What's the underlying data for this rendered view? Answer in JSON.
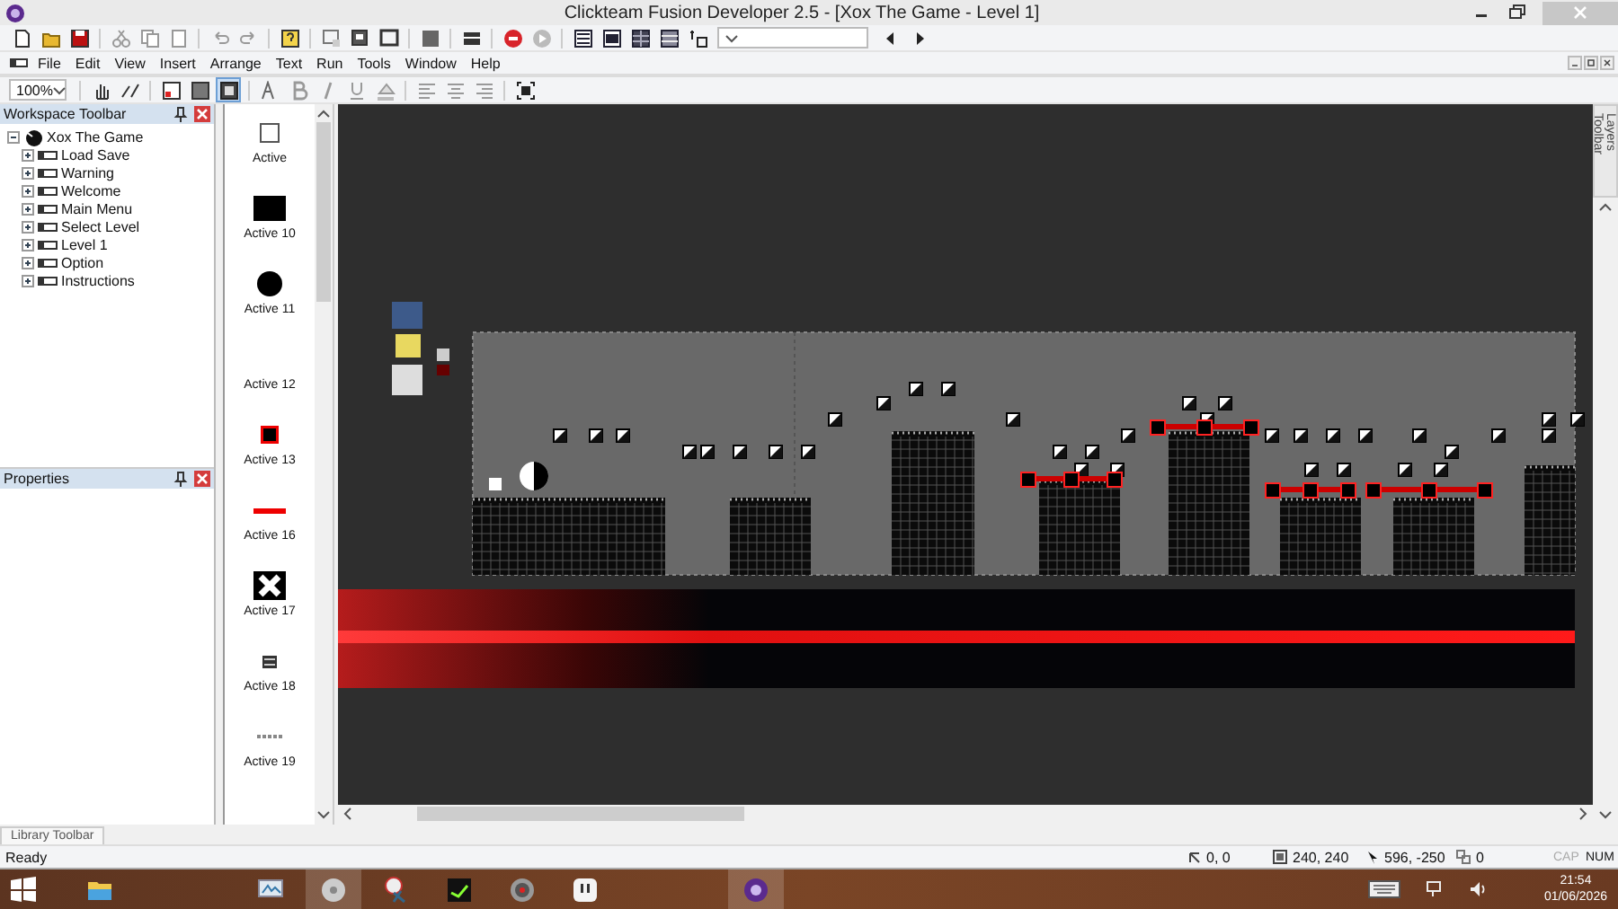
{
  "window": {
    "title": "Clickteam Fusion Developer 2.5 - [Xox The Game - Level 1]"
  },
  "menu": [
    "File",
    "Edit",
    "View",
    "Insert",
    "Arrange",
    "Text",
    "Run",
    "Tools",
    "Window",
    "Help"
  ],
  "format_bar": {
    "zoom": "100%",
    "view_toggles": [
      {
        "selected": false
      },
      {
        "selected": false
      },
      {
        "selected": true
      }
    ]
  },
  "workspace": {
    "title": "Workspace Toolbar",
    "tree": [
      {
        "label": "Xox The Game",
        "expanded": true,
        "children": [
          {
            "label": "Load Save",
            "expanded": false
          },
          {
            "label": "Warning",
            "expanded": false
          },
          {
            "label": "Welcome",
            "expanded": false
          },
          {
            "label": "Main Menu",
            "expanded": false
          },
          {
            "label": "Select Level",
            "expanded": false
          },
          {
            "label": "Level 1",
            "expanded": false
          },
          {
            "label": "Option",
            "expanded": false
          },
          {
            "label": "Instructions",
            "expanded": false
          }
        ]
      }
    ]
  },
  "properties": {
    "title": "Properties"
  },
  "objects": [
    {
      "label": "Active",
      "kind": "outline-square"
    },
    {
      "label": "Active 10",
      "kind": "black-rect"
    },
    {
      "label": "Active 11",
      "kind": "circle"
    },
    {
      "label": "Active 12",
      "kind": "blank"
    },
    {
      "label": "Active 13",
      "kind": "red-square"
    },
    {
      "label": "Active 16",
      "kind": "red-line"
    },
    {
      "label": "Active 17",
      "kind": "x-tile"
    },
    {
      "label": "Active 18",
      "kind": "sprite"
    },
    {
      "label": "Active 19",
      "kind": "text-sprite"
    }
  ],
  "layers_tab": "Layers Toolbar",
  "library_tab": "Library Toolbar",
  "status_bar": {
    "text": "Ready",
    "position": "0, 0",
    "size": "240, 240",
    "mouse": "596, -250",
    "objects": "0",
    "keys": [
      {
        "label": "CAP",
        "on": false
      },
      {
        "label": "NUM",
        "on": true
      }
    ]
  },
  "taskbar": {
    "time": "21:54",
    "date": "01/06/2026"
  }
}
